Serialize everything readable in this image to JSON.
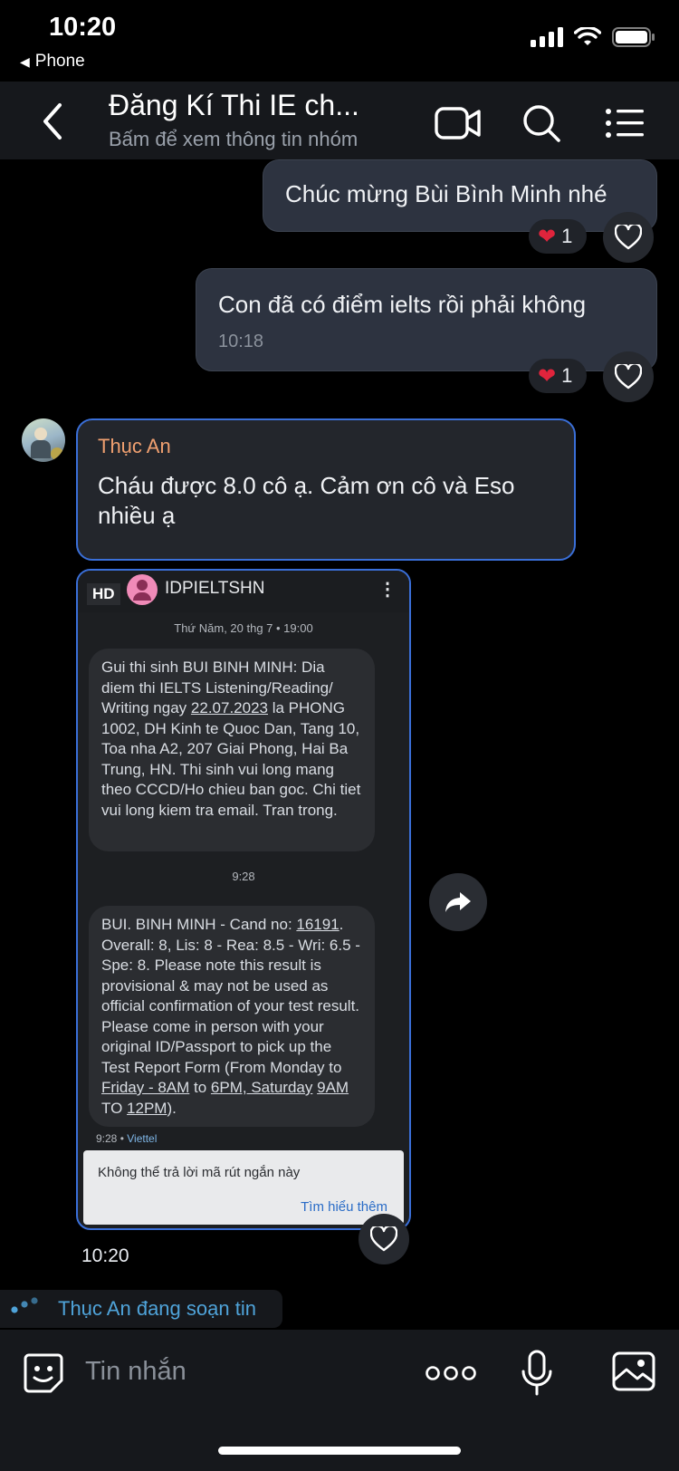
{
  "status": {
    "time": "10:20",
    "back_app": "Phone"
  },
  "header": {
    "title": "Đăng Kí Thi IE ch...",
    "subtitle": "Bấm để xem thông tin nhóm"
  },
  "messages": [
    {
      "text": "Chúc mừng Bùi Bình Minh nhé",
      "reaction_count": "1"
    },
    {
      "text": "Con đã có điểm ielts rồi phải không",
      "time": "10:18",
      "reaction_count": "1"
    }
  ],
  "incoming": {
    "sender": "Thục An",
    "text": "Cháu được 8.0 cô ạ. Cảm ơn cô và Eso nhiều ạ"
  },
  "shared_image": {
    "hd_badge": "HD",
    "sender_name": "IDPIELTSHN",
    "date_line": "Thứ Năm, 20 thg 7 • 19:00",
    "sms1_a": "Gui thi sinh BUI BINH MINH: Dia diem thi IELTS Listening/Reading/ Writing ngay ",
    "sms1_date": "22.07.2023",
    "sms1_b": " la PHONG 1002, DH Kinh te Quoc Dan, Tang 10, Toa nha A2, 207 Giai Phong, Hai Ba Trung, HN. Thi sinh vui long mang theo CCCD/Ho chieu ban goc. Chi tiet vui long kiem tra email. Tran trong.",
    "time_sep": "9:28",
    "sms2_a": "BUI. BINH MINH - Cand no: ",
    "sms2_cand": "16191",
    "sms2_b": ". Overall: 8, Lis: 8 -  Rea: 8.5 - Wri: 6.5 - Spe: 8. Please note this result is provisional & may not be used as official confirmation of your test result.  Please come in person with your original ID/Passport to pick up the Test Report Form (From Monday to ",
    "sms2_fri": "Friday - 8AM",
    "sms2_c": " to ",
    "sms2_6pm": "6PM, Saturday",
    "sms2_d": " ",
    "sms2_9am": "9AM",
    "sms2_e": " TO ",
    "sms2_12pm": "12PM",
    "sms2_f": ").",
    "footer_time": "9:28 • ",
    "carrier": "Viettel",
    "reply_note": "Không thể trả lời mã rút ngắn này",
    "learn_more": "Tìm hiểu thêm"
  },
  "image_time": "10:20",
  "typing": "Thục An đang soạn tin",
  "composer": {
    "placeholder": "Tin nhắn"
  },
  "colors": {
    "accent_border": "#3a6fd8",
    "sender_name": "#f0a070",
    "typing_text": "#4fa3d9"
  }
}
